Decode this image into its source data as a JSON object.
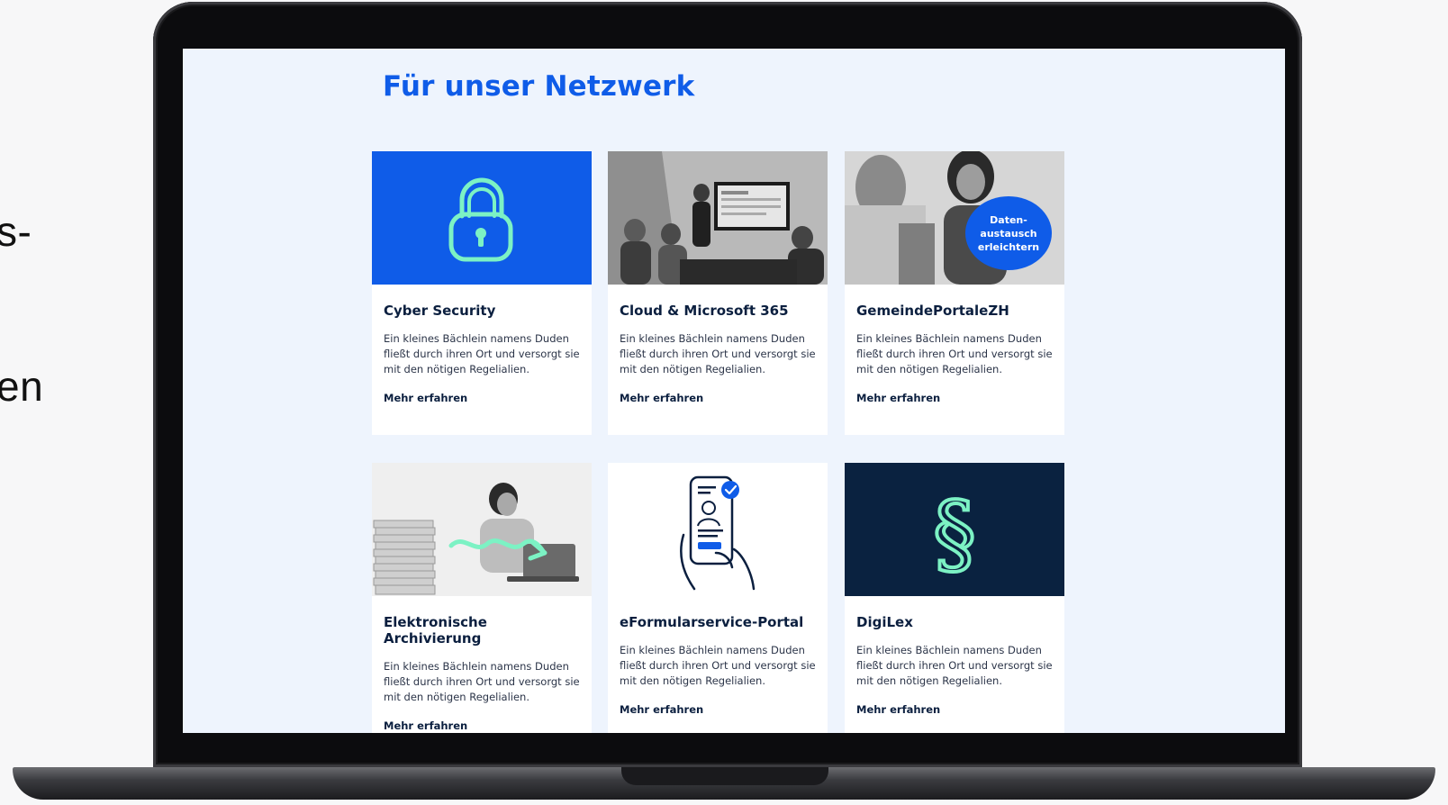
{
  "side_fragments": [
    "s-",
    "en"
  ],
  "page": {
    "title": "Für unser Netzwerk"
  },
  "cards": [
    {
      "title": "Cyber Security",
      "text": "Ein kleines Bächlein namens Duden fließt durch ihren Ort und versorgt sie mit den nötigen Regelialien.",
      "link": "Mehr erfahren",
      "image": "padlock-icon",
      "image_bg": "#0f5ce8"
    },
    {
      "title": "Cloud & Microsoft 365",
      "text": "Ein kleines Bächlein namens Duden fließt durch ihren Ort und versorgt sie mit den nötigen Regelialien.",
      "link": "Mehr erfahren",
      "image": "meeting-presentation-photo"
    },
    {
      "title": "GemeindePortaleZH",
      "text": "Ein kleines Bächlein namens Duden fließt durch ihren Ort und versorgt sie mit den nötigen Regelialien.",
      "link": "Mehr erfahren",
      "image": "smiling-woman-photo",
      "bubble": "Daten-\naustausch\nerleichtern"
    },
    {
      "title": "Elektronische Archivierung",
      "text": "Ein kleines Bächlein namens Duden fließt durch ihren Ort und versorgt sie mit den nötigen Regelialien.",
      "link": "Mehr erfahren",
      "image": "woman-with-paper-stacks-photo"
    },
    {
      "title": "eFormularservice-Portal",
      "text": "Ein kleines Bächlein namens Duden fließt durch ihren Ort und versorgt sie mit den nötigen Regelialien.",
      "link": "Mehr erfahren",
      "image": "phone-id-check-icon"
    },
    {
      "title": "DigiLex",
      "text": "Ein kleines Bächlein namens Duden fließt durch ihren Ort und versorgt sie mit den nötigen Regelialien.",
      "link": "Mehr erfahren",
      "image": "paragraph-symbol-icon",
      "image_bg": "#0a2240"
    }
  ],
  "colors": {
    "brand_blue": "#0f5ce8",
    "navy": "#0a2240",
    "mint": "#7cf2c4",
    "screen_bg": "#eef4fd"
  }
}
